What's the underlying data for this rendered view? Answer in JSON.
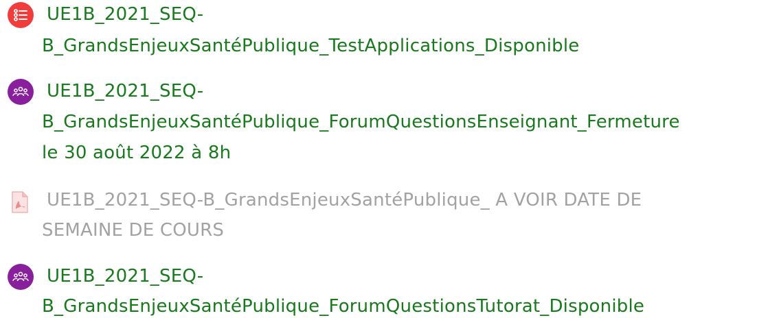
{
  "activities": [
    {
      "type": "quiz",
      "icon": "quiz-list-icon",
      "line1": "UE1B_2021_SEQ-",
      "line2": "B_GrandsEnjeuxSantéPublique_TestApplications_Disponible",
      "color": "#187a1c"
    },
    {
      "type": "forum",
      "icon": "forum-people-icon",
      "line1": "UE1B_2021_SEQ-",
      "line2": "B_GrandsEnjeuxSantéPublique_ForumQuestionsEnseignant_Fermeture",
      "line3": "le 30 août 2022 à 8h",
      "color": "#187a1c"
    },
    {
      "type": "file",
      "icon": "pdf-file-icon",
      "line1": "UE1B_2021_SEQ-B_GrandsEnjeuxSantéPublique_ A VOIR DATE DE",
      "line2": "SEMAINE DE COURS",
      "color": "#a2a2a2",
      "dimmed": true
    },
    {
      "type": "forum",
      "icon": "forum-people-icon",
      "line1": "UE1B_2021_SEQ-",
      "line2": "B_GrandsEnjeuxSantéPublique_ForumQuestionsTutorat_Disponible",
      "color": "#187a1c"
    }
  ]
}
